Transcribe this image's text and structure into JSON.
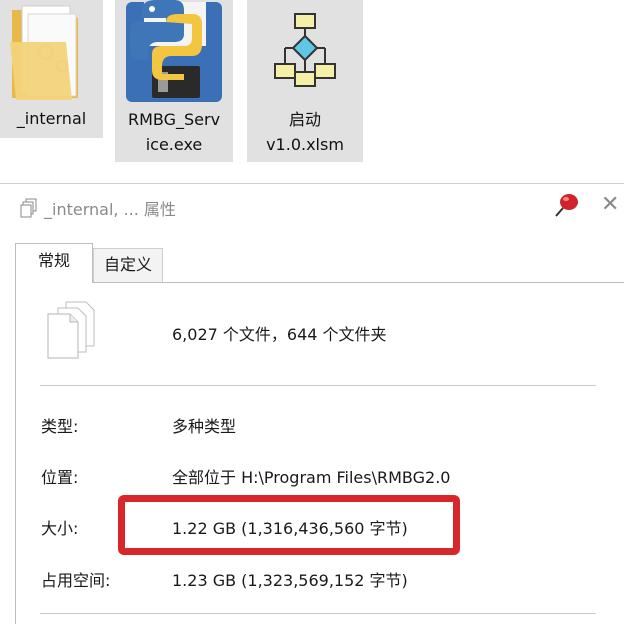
{
  "files": [
    {
      "name": "_internal",
      "icon": "folder-icon"
    },
    {
      "name_line1": "RMBG_Serv",
      "name_line2": "ice.exe",
      "icon": "python-exe-icon"
    },
    {
      "name_line1": "启动",
      "name_line2": "v1.0.xlsm",
      "icon": "flowchart-xlsm-icon"
    }
  ],
  "dialog": {
    "title": "_internal, ... 属性",
    "tabs": [
      {
        "label": "常规",
        "active": true
      },
      {
        "label": "自定义",
        "active": false
      }
    ],
    "summary": "6,027 个文件，644 个文件夹",
    "properties": {
      "type": {
        "label": "类型:",
        "value": "多种类型"
      },
      "location": {
        "label": "位置:",
        "value": "全部位于 H:\\Program Files\\RMBG2.0"
      },
      "size": {
        "label": "大小:",
        "value": "1.22 GB (1,316,436,560 字节)"
      },
      "disk": {
        "label": "占用空间:",
        "value": "1.23 GB (1,323,569,152 字节)"
      }
    }
  },
  "colors": {
    "highlight": "#d8262b",
    "selection": "#e1e1e1",
    "folder": "#f3d37a"
  }
}
